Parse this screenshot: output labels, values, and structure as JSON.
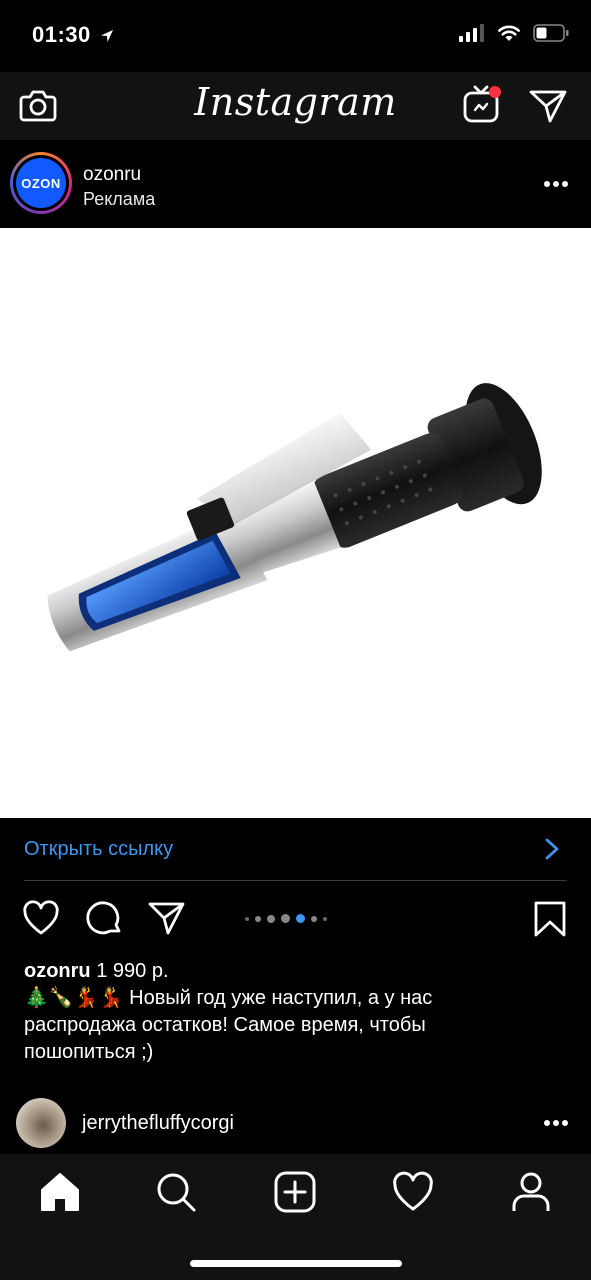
{
  "status_bar": {
    "time": "01:30"
  },
  "nav": {
    "logo": "Instagram"
  },
  "post": {
    "username": "ozonru",
    "sponsored_label": "Реклама",
    "avatar_logo_text": "OZON",
    "avatar_color": "#1259ff",
    "cta_label": "Открыть ссылку",
    "cta_color": "#3d96f0",
    "carousel": {
      "total_dots": 7,
      "active_index": 4
    },
    "caption": {
      "username": "ozonru",
      "price": "1 990 р.",
      "emoji": "🎄🍾💃💃",
      "line1": "Новый год уже наступил, а у нас",
      "line2": "распродажа остатков! Самое время, чтобы",
      "line3": "пошопиться ;)"
    }
  },
  "next_post": {
    "username": "jerrythefluffycorgi"
  },
  "icons": {
    "nav": [
      "camera-icon",
      "igtv-icon",
      "direct-icon"
    ],
    "actions": [
      "heart-icon",
      "comment-icon",
      "share-icon",
      "bookmark-icon"
    ],
    "tabs": [
      "home-icon",
      "search-icon",
      "add-icon",
      "activity-icon",
      "profile-icon"
    ]
  },
  "colors": {
    "background": "#000000",
    "bar_background": "#121212",
    "notification_dot": "#ff3040"
  }
}
